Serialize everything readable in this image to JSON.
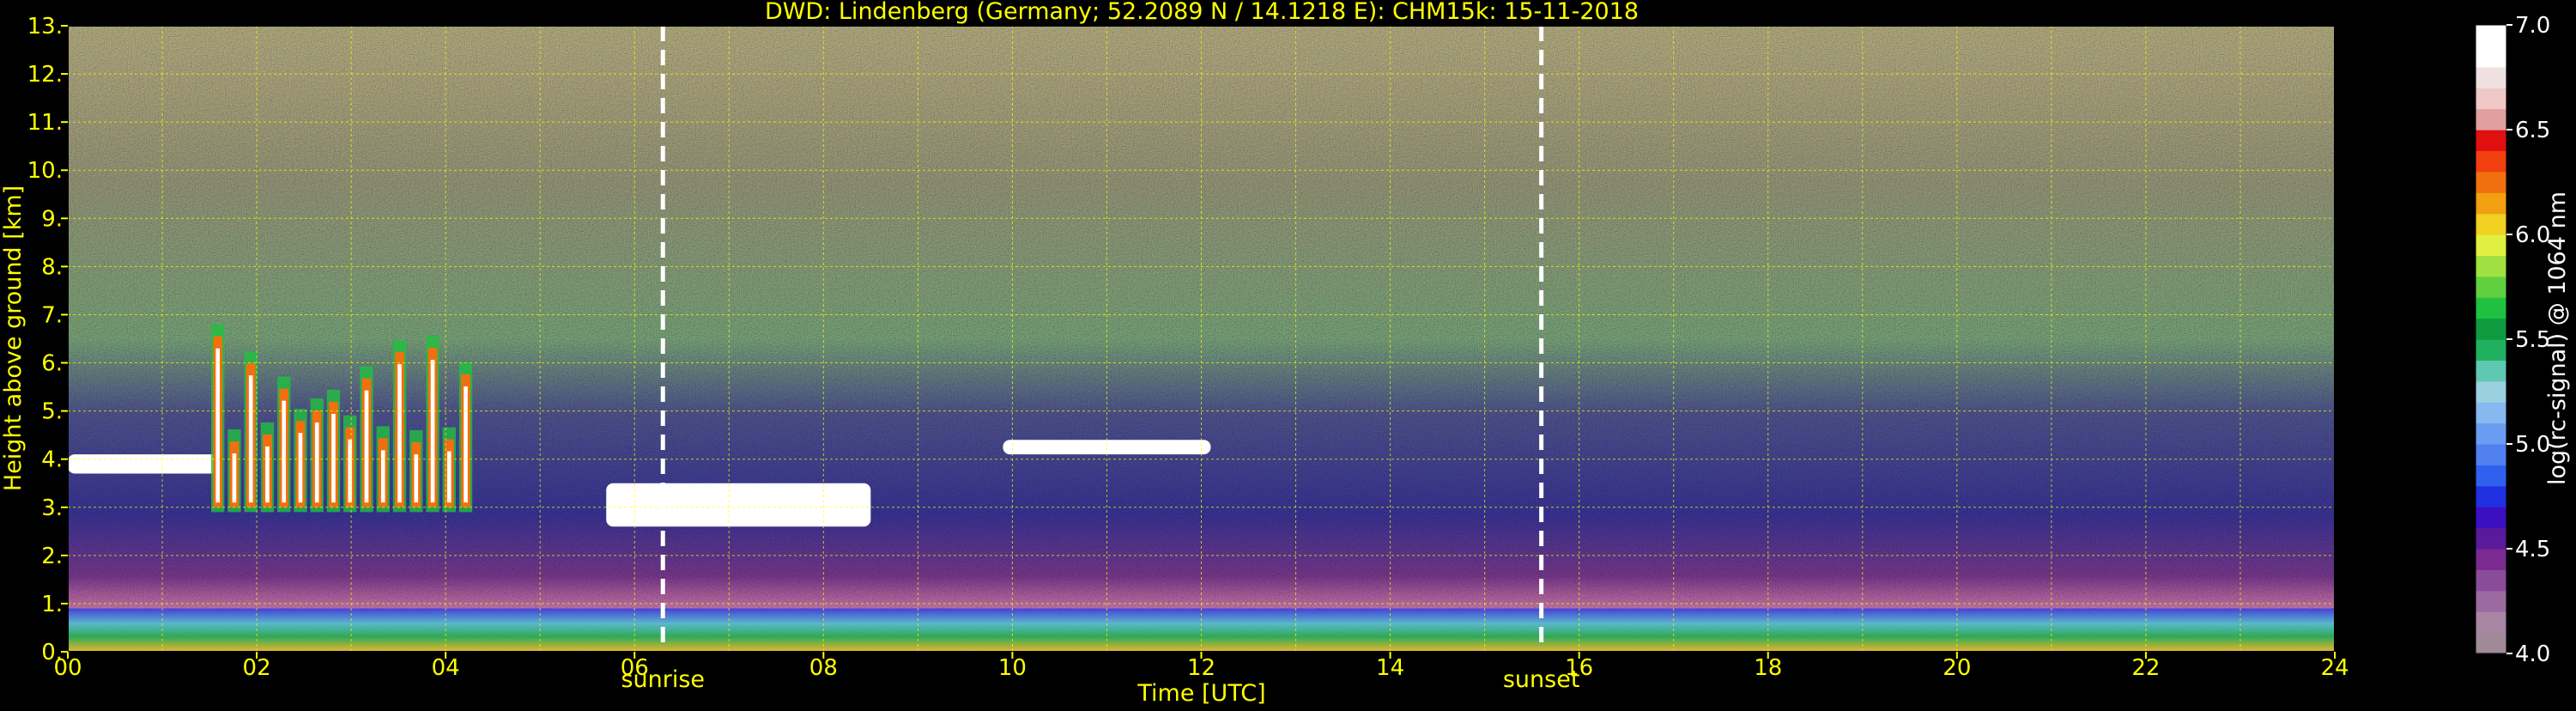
{
  "chart_data": {
    "type": "heatmap",
    "title": "DWD: Lindenberg (Germany; 52.2089 N / 14.1218 E):    CHM15k: 15-11-2018",
    "xlabel": "Time [UTC]",
    "ylabel": "Height above ground [km]",
    "xlim": [
      0,
      24
    ],
    "ylim": [
      0,
      13
    ],
    "x_ticks": [
      "00",
      "02",
      "04",
      "06",
      "08",
      "10",
      "12",
      "14",
      "16",
      "18",
      "20",
      "22",
      "24"
    ],
    "y_ticks": [
      "0.",
      "1.",
      "2.",
      "3.",
      "4.",
      "5.",
      "6.",
      "7.",
      "8.",
      "9.",
      "10.",
      "11.",
      "12.",
      "13."
    ],
    "grid": true,
    "markers": [
      {
        "label": "sunrise",
        "time": 6.3
      },
      {
        "label": "sunset",
        "time": 15.6
      }
    ],
    "colorbar": {
      "label": "log(rc-signal) @ 1064 nm",
      "range": [
        4.0,
        7.0
      ],
      "ticks": [
        "4.0",
        "4.5",
        "5.0",
        "5.5",
        "6.0",
        "6.5",
        "7.0"
      ],
      "colors": [
        "#a08a98",
        "#a985a4",
        "#9a6aa0",
        "#8a4b98",
        "#7a2a90",
        "#5a1a9a",
        "#3a10c0",
        "#2030e0",
        "#3060f0",
        "#5080f0",
        "#6a9cf0",
        "#88b8f0",
        "#9ad0e0",
        "#60c8b0",
        "#20b060",
        "#109a40",
        "#20c040",
        "#60d040",
        "#a0e040",
        "#e0f040",
        "#f0d020",
        "#f0a010",
        "#f07010",
        "#f04010",
        "#e01010",
        "#e0a0a0",
        "#f0c8c8",
        "#f0e0e0",
        "#ffffff",
        "#ffffff"
      ]
    },
    "features": [
      {
        "name": "cloud",
        "t_start": 0.0,
        "t_end": 1.6,
        "h_bottom": 3.7,
        "h_top": 4.1
      },
      {
        "name": "precipitating cloud",
        "t_start": 1.5,
        "t_end": 4.3,
        "h_bottom": 2.9,
        "h_top": 6.8
      },
      {
        "name": "cloud",
        "t_start": 5.7,
        "t_end": 8.5,
        "h_bottom": 2.6,
        "h_top": 3.5
      },
      {
        "name": "cloud",
        "t_start": 9.9,
        "t_end": 12.1,
        "h_bottom": 4.1,
        "h_top": 4.4
      },
      {
        "name": "boundary layer",
        "t_start": 0.0,
        "t_end": 24.0,
        "h_bottom": 0.0,
        "h_top": 0.9
      }
    ]
  }
}
